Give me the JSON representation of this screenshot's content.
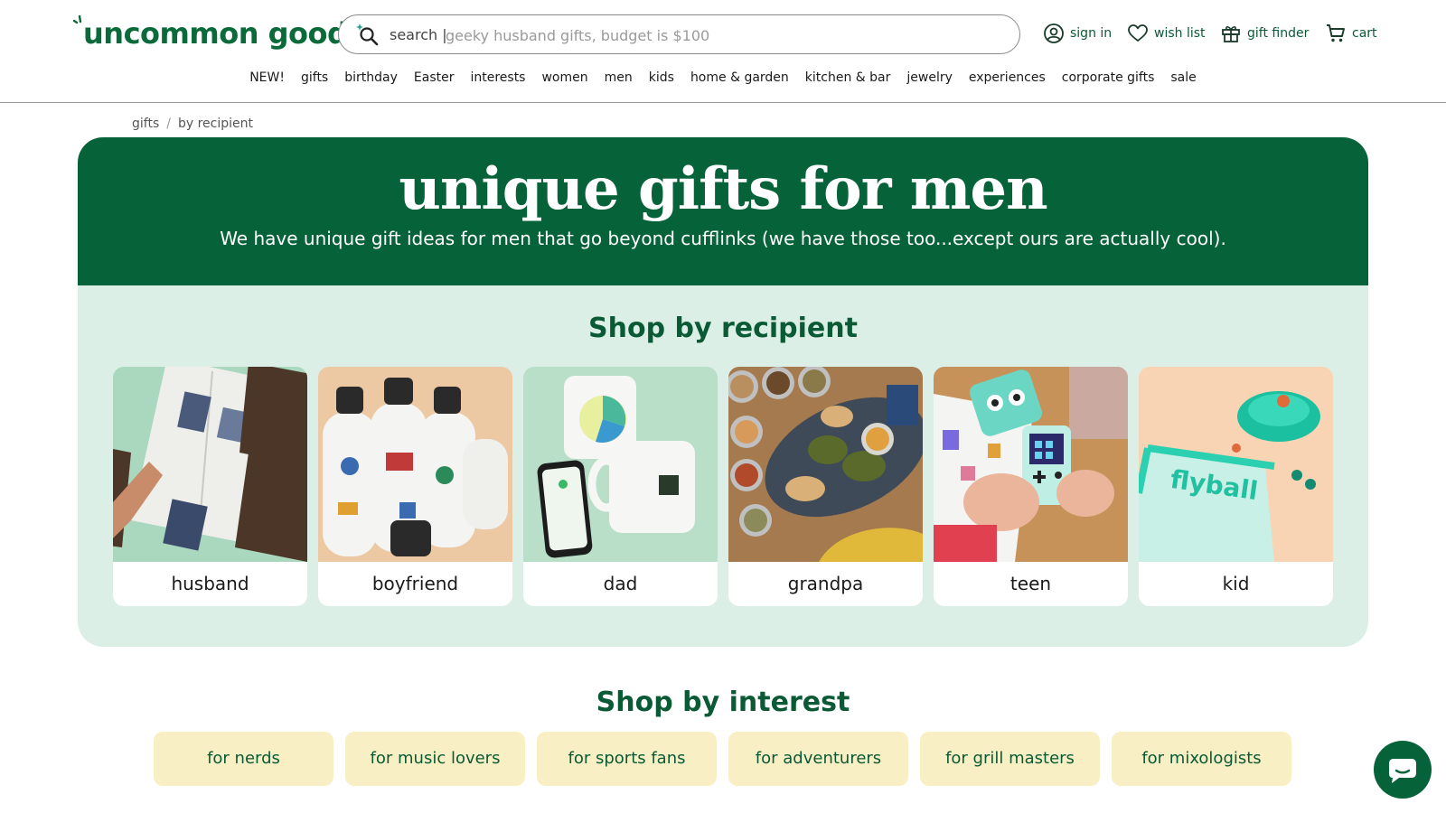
{
  "brand": {
    "name": "uncommon goods",
    "color": "#066339"
  },
  "search": {
    "label": "search |",
    "placeholder": "geeky husband gifts, budget is $100",
    "value": ""
  },
  "utility": [
    {
      "label": "sign in",
      "icon": "user-circle-icon"
    },
    {
      "label": "wish list",
      "icon": "heart-icon"
    },
    {
      "label": "gift finder",
      "icon": "gift-icon"
    },
    {
      "label": "cart",
      "icon": "cart-icon"
    }
  ],
  "nav": [
    "NEW!",
    "gifts",
    "birthday",
    "Easter",
    "interests",
    "women",
    "men",
    "kids",
    "home & garden",
    "kitchen & bar",
    "jewelry",
    "experiences",
    "corporate gifts",
    "sale"
  ],
  "breadcrumb": {
    "items": [
      "gifts",
      "by recipient"
    ],
    "separator": "/"
  },
  "hero": {
    "title": "unique gifts for men",
    "subtitle": "We have unique gift ideas for men that go beyond cufflinks (we have those too...except ours are actually cool)."
  },
  "recipients": {
    "title": "Shop by recipient",
    "items": [
      "husband",
      "boyfriend",
      "dad",
      "grandpa",
      "teen",
      "kid"
    ]
  },
  "interests": {
    "title": "Shop by interest",
    "items": [
      "for nerds",
      "for music lovers",
      "for sports fans",
      "for adventurers",
      "for grill masters",
      "for mixologists"
    ]
  },
  "colors": {
    "accent": "#066339",
    "panel": "#dcefe6",
    "chip": "#f9efc4",
    "text_green": "#0a5a35"
  }
}
